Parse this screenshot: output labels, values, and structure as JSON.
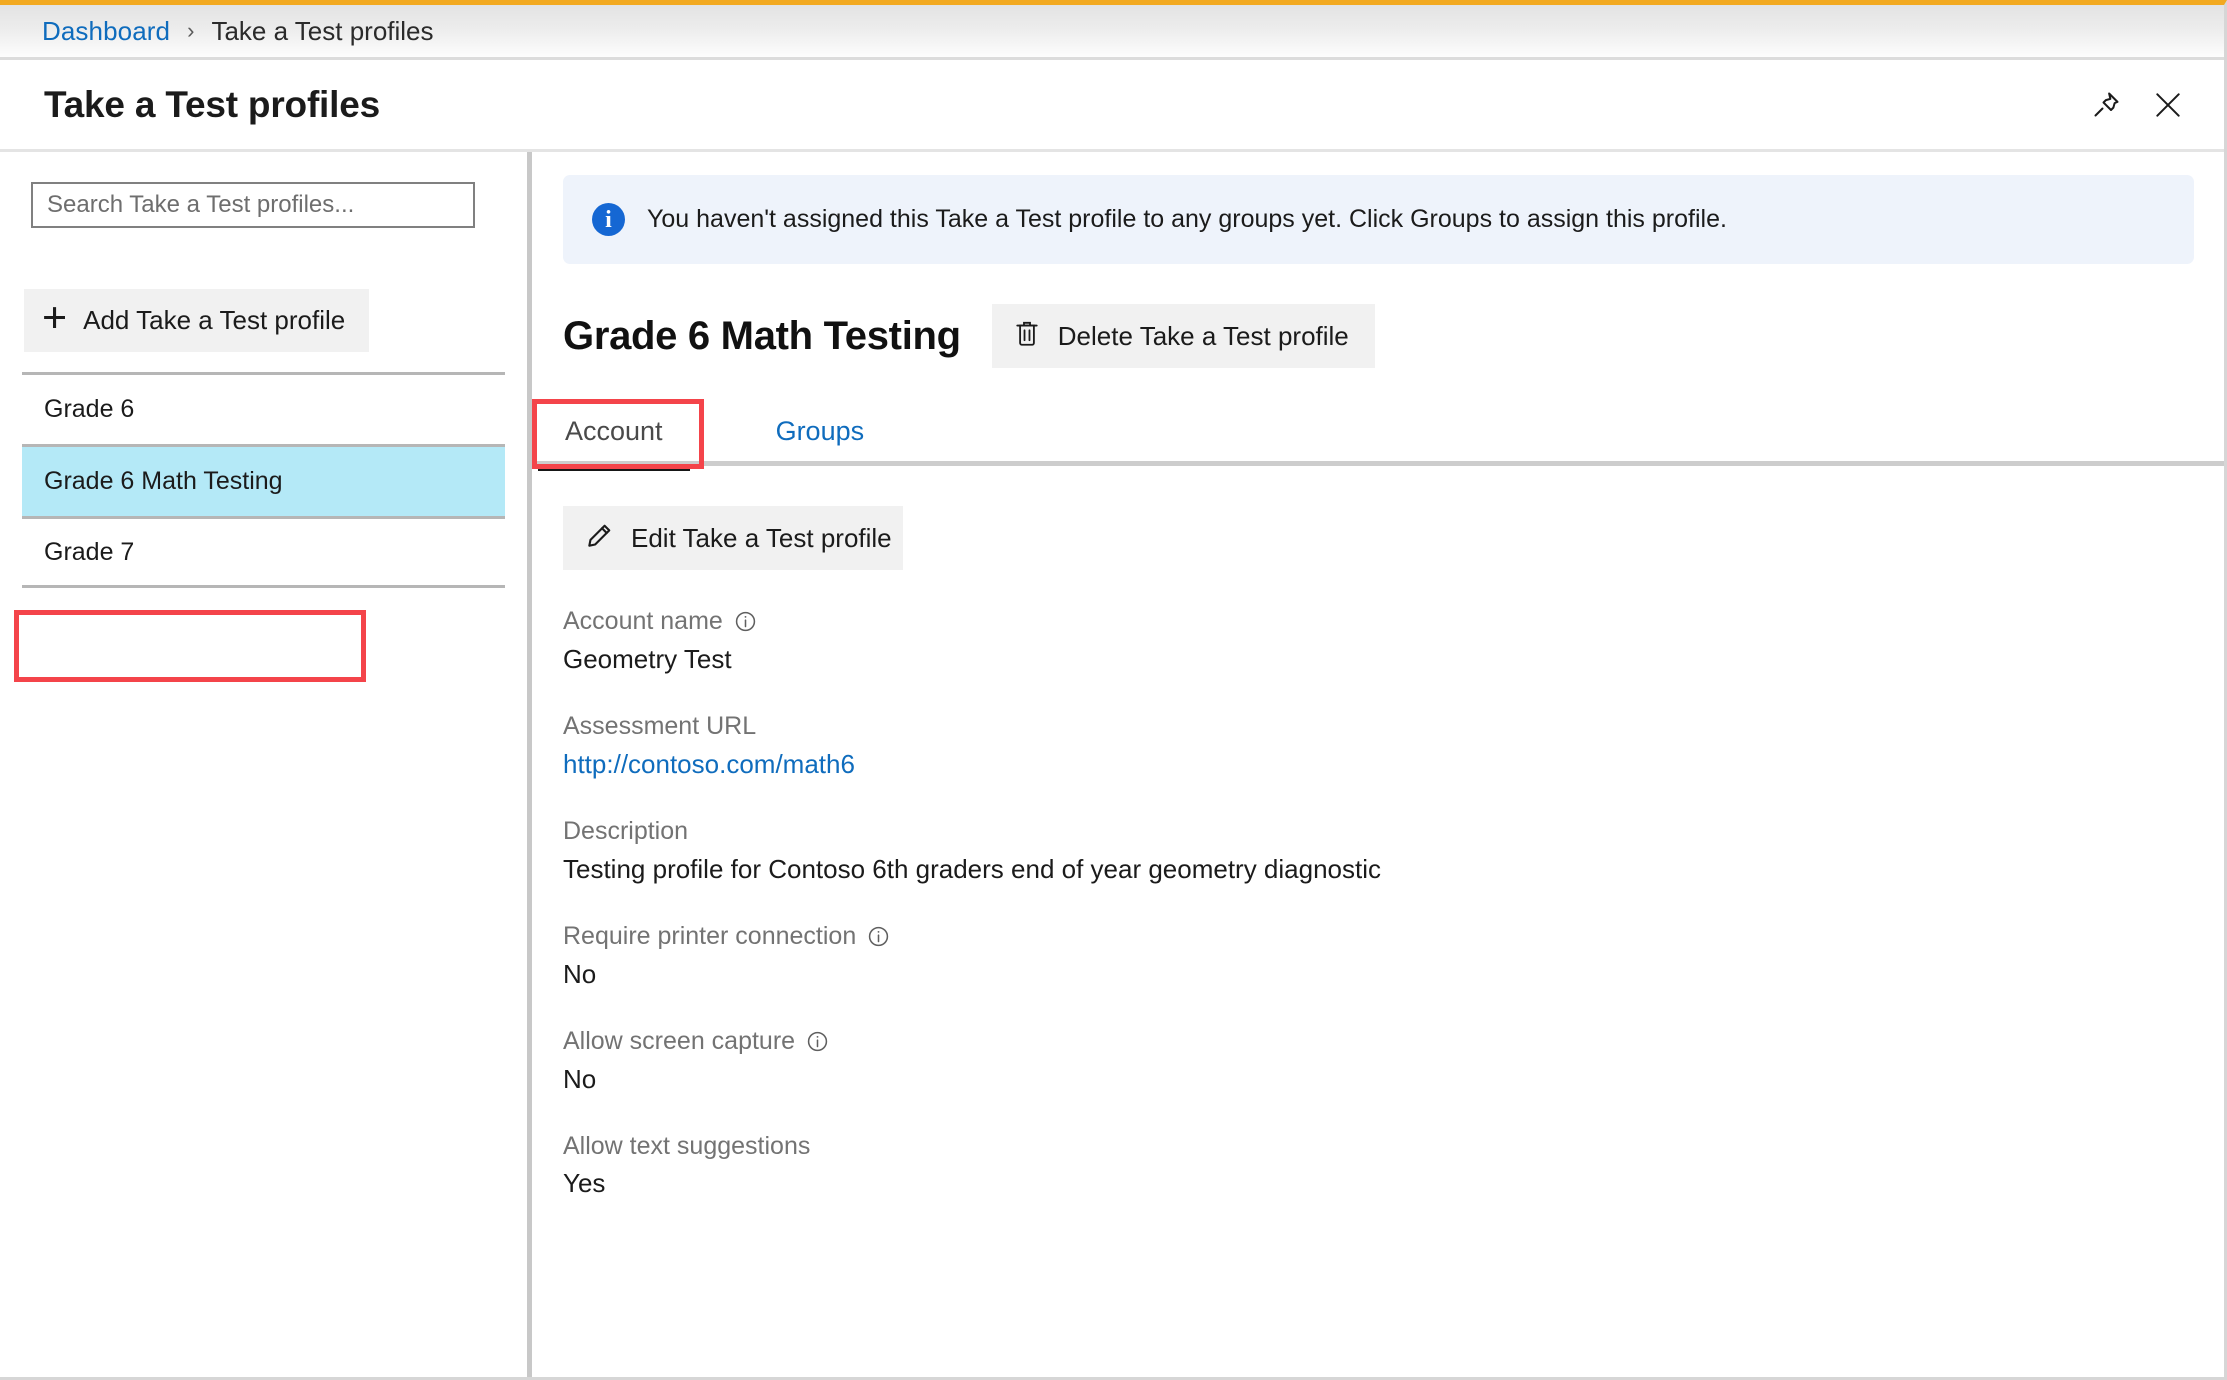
{
  "breadcrumb": {
    "root": "Dashboard",
    "separator": "›",
    "current": "Take a Test profiles"
  },
  "header": {
    "title": "Take a Test profiles",
    "pin_icon": "pin-icon",
    "close_icon": "close-icon"
  },
  "sidebar": {
    "search": {
      "placeholder": "Search Take a Test profiles...",
      "value": ""
    },
    "add_button": {
      "label": "Add Take a Test profile",
      "icon": "plus-icon"
    },
    "items": [
      {
        "label": "Grade 6",
        "selected": false
      },
      {
        "label": "Grade 6 Math Testing",
        "selected": true
      },
      {
        "label": "Grade 7",
        "selected": false
      }
    ]
  },
  "main": {
    "banner": {
      "icon": "info-circle-icon",
      "glyph": "i",
      "text": "You haven't assigned this Take a Test profile to any groups yet. Click Groups to assign this profile."
    },
    "profile_title": "Grade 6 Math Testing",
    "delete_button": {
      "label": "Delete Take a Test profile",
      "icon": "trash-icon"
    },
    "tabs": [
      {
        "label": "Account",
        "active": true
      },
      {
        "label": "Groups",
        "active": false
      }
    ],
    "edit_button": {
      "label": "Edit Take a Test profile",
      "icon": "pencil-icon"
    },
    "fields": [
      {
        "label": "Account name",
        "value": "Geometry Test",
        "has_info": true,
        "is_link": false
      },
      {
        "label": "Assessment URL",
        "value": "http://contoso.com/math6",
        "has_info": false,
        "is_link": true
      },
      {
        "label": "Description",
        "value": "Testing profile for Contoso 6th graders end of year geometry diagnostic",
        "has_info": false,
        "is_link": false
      },
      {
        "label": "Require printer connection",
        "value": "No",
        "has_info": true,
        "is_link": false
      },
      {
        "label": "Allow screen capture",
        "value": "No",
        "has_info": true,
        "is_link": false
      },
      {
        "label": "Allow text suggestions",
        "value": "Yes",
        "has_info": false,
        "is_link": false
      }
    ]
  },
  "colors": {
    "accent_link": "#0f6cbd",
    "selection": "#b4e9f7",
    "annotation": "#f4444a",
    "banner_bg": "#eef3fb",
    "top_border": "#f2a920"
  }
}
